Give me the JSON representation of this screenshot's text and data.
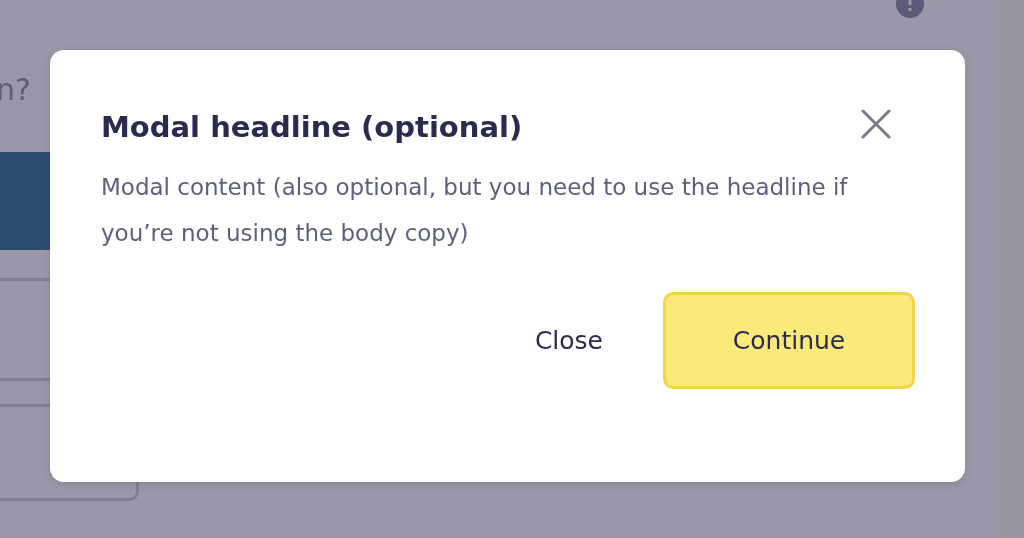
{
  "background": {
    "question_fragment": "n?"
  },
  "modal": {
    "headline": "Modal headline (optional)",
    "content": "Modal content (also optional, but you need to use the headline if you’re not using the body copy)",
    "buttons": [
      {
        "label": "Close",
        "kind": "secondary"
      },
      {
        "label": "Continue",
        "kind": "primary"
      }
    ]
  }
}
